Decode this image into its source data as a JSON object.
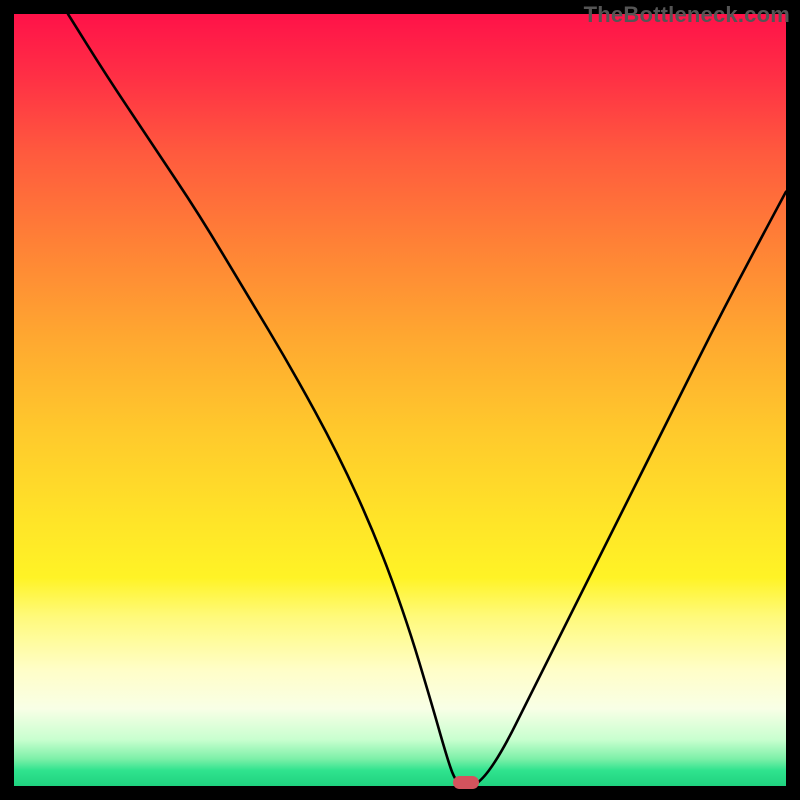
{
  "watermark": "TheBottleneck.com",
  "colors": {
    "gradient_top": "#ff1249",
    "gradient_mid": "#ffe528",
    "gradient_bottom": "#1fd27f",
    "curve": "#000000",
    "marker": "#d3535d",
    "frame": "#000000"
  },
  "chart_data": {
    "type": "line",
    "title": "",
    "xlabel": "",
    "ylabel": "",
    "xlim": [
      0,
      100
    ],
    "ylim": [
      0,
      100
    ],
    "grid": false,
    "legend": false,
    "series": [
      {
        "name": "bottleneck-curve",
        "x": [
          7,
          12,
          18,
          24,
          30,
          36,
          42,
          47,
          51,
          54,
          56,
          57,
          58,
          60,
          63,
          67,
          72,
          78,
          85,
          92,
          100
        ],
        "y": [
          100,
          92,
          83,
          74,
          64,
          54,
          43,
          32,
          21,
          11,
          4,
          1,
          0,
          0,
          4,
          12,
          22,
          34,
          48,
          62,
          77
        ]
      }
    ],
    "annotations": [
      {
        "name": "optimal-marker",
        "x": 58.5,
        "y": 0.5,
        "shape": "pill",
        "color": "#d3535d"
      }
    ],
    "note": "x/y are in percent of the plot area (0–100); y=0 is the bottom green band, y=100 is the top edge."
  }
}
